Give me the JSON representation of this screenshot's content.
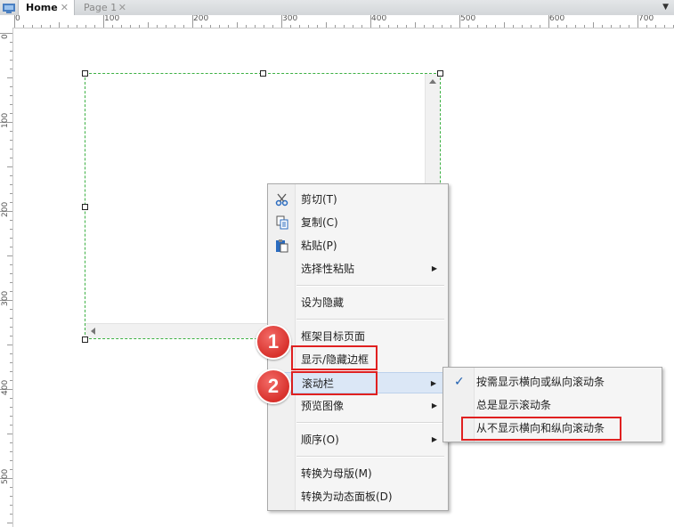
{
  "tabs": [
    {
      "label": "Home",
      "close": "✕"
    },
    {
      "label": "Page 1",
      "close": "✕"
    }
  ],
  "tab_menu_arrow": "▼",
  "ruler": {
    "top_labels": [
      "0",
      "100",
      "200",
      "300",
      "400",
      "500",
      "600",
      "700"
    ],
    "left_labels": [
      "0",
      "100",
      "200",
      "300",
      "400",
      "500"
    ]
  },
  "context_menu": {
    "items": [
      {
        "label": "剪切(T)",
        "icon": "scissors-icon"
      },
      {
        "label": "复制(C)",
        "icon": "copy-icon"
      },
      {
        "label": "粘贴(P)",
        "icon": "paste-icon"
      },
      {
        "label": "选择性粘贴",
        "submenu": "▶"
      },
      {
        "label": "设为隐藏"
      },
      {
        "label": "框架目标页面"
      },
      {
        "label": "显示/隐藏边框"
      },
      {
        "label": "滚动栏",
        "submenu": "▶",
        "highlighted": true
      },
      {
        "label": "预览图像",
        "submenu": "▶"
      },
      {
        "label": "顺序(O)",
        "submenu": "▶"
      },
      {
        "label": "转换为母版(M)"
      },
      {
        "label": "转换为动态面板(D)"
      }
    ]
  },
  "scrollbar_submenu": {
    "items": [
      {
        "label": "按需显示横向或纵向滚动条",
        "checked": "✓"
      },
      {
        "label": "总是显示滚动条"
      },
      {
        "label": "从不显示横向和纵向滚动条"
      }
    ]
  },
  "callouts": [
    "1",
    "2"
  ],
  "colors": {
    "selection_border": "#3cb043",
    "highlight_box": "#e02020",
    "badge": "#d8312c",
    "menu_highlight": "#dbe7f6",
    "check": "#1f5fb0"
  }
}
